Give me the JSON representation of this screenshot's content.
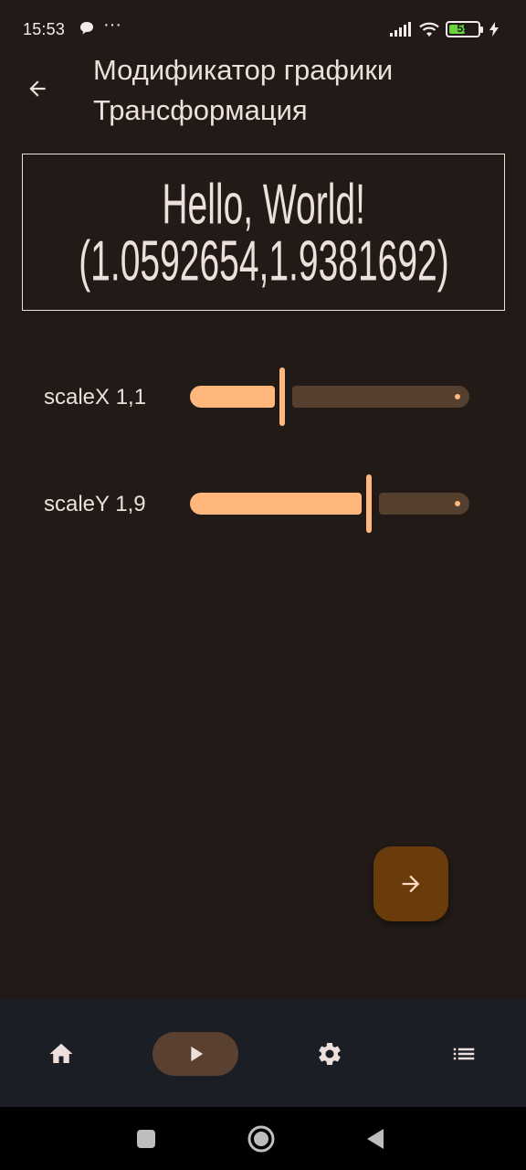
{
  "status_bar": {
    "time": "15:53",
    "dots": "···",
    "battery_level": "55",
    "battery_fraction": 0.55
  },
  "app_bar": {
    "title_line1": "Модификатор графики",
    "title_line2": "Трансформация"
  },
  "display": {
    "line1": "Hello, World!",
    "line2": "(1.0592654,1.9381692)"
  },
  "sliders": [
    {
      "label": "scaleX 1,1",
      "fraction": 0.33
    },
    {
      "label": "scaleY 1,9",
      "fraction": 0.64
    }
  ],
  "colors": {
    "background": "#211a17",
    "on_surface": "#ede0dc",
    "primary": "#ffb77c",
    "slider_inactive": "#553f2e",
    "fab": "#6a3b0b",
    "nav_background": "#1c1e26",
    "nav_indicator": "#5a4030"
  },
  "icons": {
    "back": "arrow-back-icon",
    "fab": "arrow-forward-icon",
    "nav": [
      "home-icon",
      "play-icon",
      "settings-icon",
      "list-icon"
    ],
    "system": [
      "square-recents-icon",
      "circle-home-icon",
      "triangle-back-icon"
    ]
  }
}
